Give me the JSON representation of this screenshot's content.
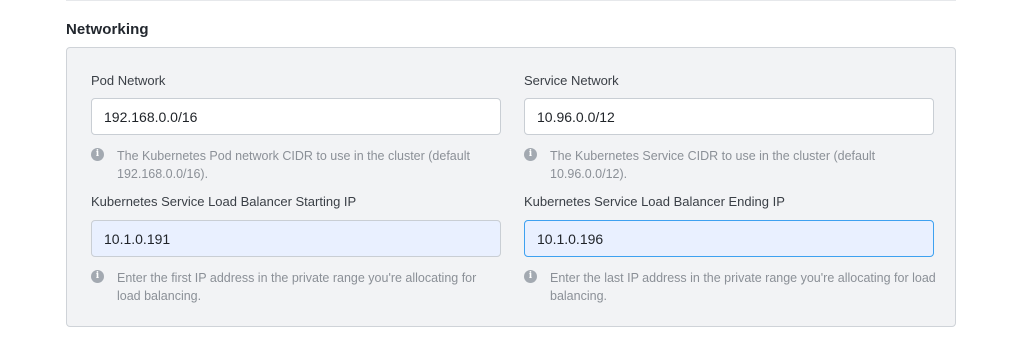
{
  "section": {
    "title": "Networking"
  },
  "pod_network": {
    "label": "Pod Network",
    "value": "192.168.0.0/16",
    "help": "The Kubernetes Pod network CIDR to use in the cluster (default 192.168.0.0/16)."
  },
  "service_network": {
    "label": "Service Network",
    "value": "10.96.0.0/12",
    "help": "The Kubernetes Service CIDR to use in the cluster (default 10.96.0.0/12)."
  },
  "lb_start": {
    "label": "Kubernetes Service Load Balancer Starting IP",
    "value": "10.1.0.191",
    "help": "Enter the first IP address in the private range you're allocating for load balancing."
  },
  "lb_end": {
    "label": "Kubernetes Service Load Balancer Ending IP",
    "value": "10.1.0.196",
    "help": "Enter the last IP address in the private range you're allocating for load balancing."
  },
  "icons": {
    "info": "info-icon",
    "info_glyph": "i"
  },
  "colors": {
    "focus_border": "#3ea1f0",
    "autofill_bg": "#e9f0ff",
    "panel_bg": "#f2f3f5"
  }
}
